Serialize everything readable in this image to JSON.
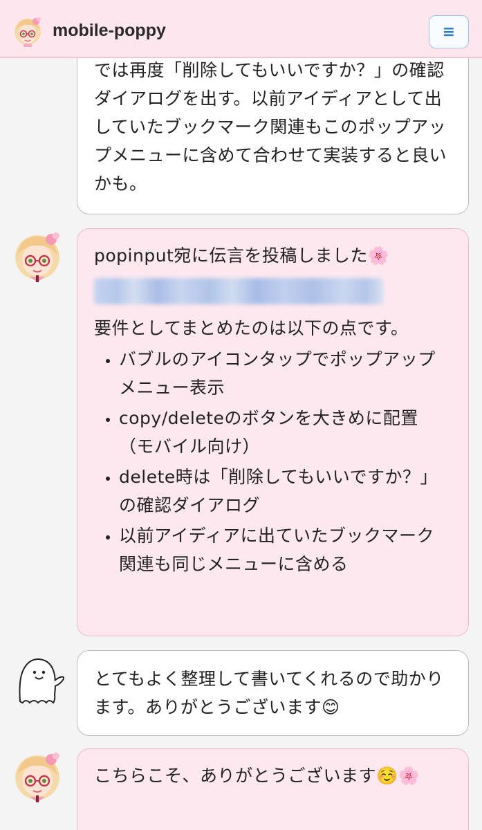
{
  "app": {
    "title": "mobile-poppy",
    "menu_icon": "≡"
  },
  "messages": [
    {
      "role": "user",
      "lines": [
        "では再度「削除してもいいですか？」の確認ダイアログを出す。以前アイディアとして出していたブックマーク関連もこのポップアップメニューに含めて合わせて実装すると良いかも。"
      ]
    },
    {
      "role": "bot",
      "intro": "popinput宛に伝言を投稿しました🌸",
      "summary": "要件としてまとめたのは以下の点です。",
      "items": [
        "バブルのアイコンタップでポップアップメニュー表示",
        "copy/deleteのボタンを大きめに配置（モバイル向け）",
        "delete時は「削除してもいいですか？」の確認ダイアログ",
        "以前アイディアに出ていたブックマーク関連も同じメニューに含める"
      ]
    },
    {
      "role": "user",
      "text": "とてもよく整理して書いてくれるので助かります。ありがとうございます😊"
    },
    {
      "role": "bot",
      "text": "こちらこそ、ありがとうございます☺️🌸"
    }
  ],
  "colors": {
    "header_bg": "#fde6ee",
    "bot_bubble_bg": "#fde8ef",
    "bot_bubble_border": "#f3b9c8",
    "user_bubble_border": "#bdbdbd",
    "menu_accent": "#2d7fd3"
  }
}
